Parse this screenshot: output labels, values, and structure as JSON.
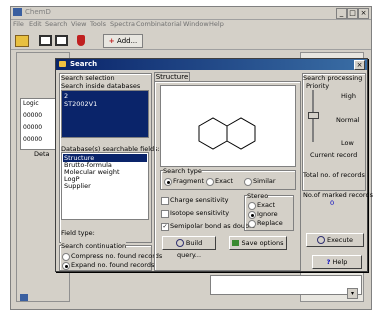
{
  "app": {
    "title": "ChemD",
    "menu": [
      "File",
      "Edit",
      "Search",
      "View",
      "Tools",
      "Spectra",
      "Combinatorial",
      "Window",
      "Help"
    ],
    "add_label": "Add...",
    "side_items": [
      "Logic",
      "00000",
      "00000",
      "00000"
    ],
    "detail_tab": "Deta"
  },
  "dialog": {
    "title": "Search",
    "search_selection": {
      "group_label": "Search selection",
      "databases_label": "Search inside databases",
      "databases": [
        "2",
        "ST2002V1"
      ],
      "fields_label": "Database(s) searchable fields:",
      "fields": [
        "Structure",
        "Brutto-formula",
        "Molecular weight",
        "LogP",
        "Supplier"
      ],
      "field_type_label": "Field type:"
    },
    "search_continuation": {
      "label": "Search continuation",
      "options": [
        "Compress no. found records",
        "Expand no. found records"
      ],
      "selected_index": 1
    },
    "structure_tab": "Structure",
    "search_type": {
      "label": "Search type",
      "options": [
        "Fragment",
        "Exact",
        "Similar"
      ],
      "selected_index": 0
    },
    "checks": [
      {
        "label": "Charge sensitivity",
        "checked": false
      },
      {
        "label": "Isotope sensitivity",
        "checked": false
      },
      {
        "label": "Semipolar bond as double",
        "checked": true
      }
    ],
    "stereo": {
      "label": "Stereo",
      "options": [
        "Exact",
        "Ignore",
        "Replace"
      ],
      "selected_index": 1
    },
    "build_query_label": "Build query...",
    "save_options_label": "Save options",
    "processing": {
      "label": "Search processing",
      "priority_label": "Priority",
      "levels": [
        "High",
        "Normal",
        "Low"
      ],
      "current_record_label": "Current record",
      "total_records_label": "Total no. of records",
      "marked_records_label": "No.of marked records",
      "marked_records_value": "0"
    },
    "execute_label": "Execute",
    "help_label": "Help"
  }
}
